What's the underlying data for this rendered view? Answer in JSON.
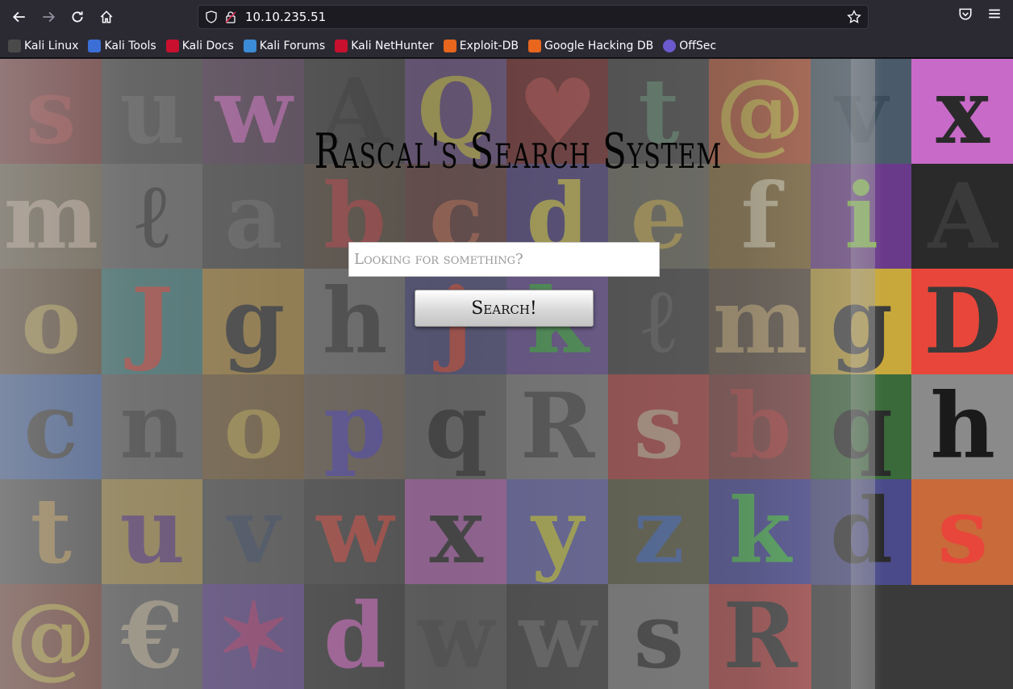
{
  "browser": {
    "url": "10.10.235.51",
    "bookmarks": [
      {
        "label": "Kali Linux",
        "color": "#4a4a4a"
      },
      {
        "label": "Kali Tools",
        "color": "#3b6fd6"
      },
      {
        "label": "Kali Docs",
        "color": "#c8102e"
      },
      {
        "label": "Kali Forums",
        "color": "#3b8bd6"
      },
      {
        "label": "Kali NetHunter",
        "color": "#c8102e"
      },
      {
        "label": "Exploit-DB",
        "color": "#e8661e"
      },
      {
        "label": "Google Hacking DB",
        "color": "#e8661e"
      },
      {
        "label": "OffSec",
        "color": "#6a5acd"
      }
    ]
  },
  "page": {
    "title": "Rascal's Search System",
    "search_placeholder": "Looking for something?",
    "search_button": "Search!"
  },
  "background_tiles": [
    {
      "ch": "s",
      "color": "#c83a3a",
      "bg": "#8a2a2a"
    },
    {
      "ch": "u",
      "color": "#6a6a6a",
      "bg": "#4b4b4b"
    },
    {
      "ch": "w",
      "color": "#e86ad6",
      "bg": "#5a3a5a"
    },
    {
      "ch": "A",
      "color": "#2a2a2a",
      "bg": "#3a3a3a"
    },
    {
      "ch": "Q",
      "color": "#d8c84a",
      "bg": "#6a4a8a"
    },
    {
      "ch": "♥",
      "color": "#c83a3a",
      "bg": "#7a1a1a"
    },
    {
      "ch": "t",
      "color": "#5a8a6a",
      "bg": "#3a3a3a"
    },
    {
      "ch": "@",
      "color": "#e8c23a",
      "bg": "#c8502a"
    },
    {
      "ch": "v",
      "color": "#3a4a5a",
      "bg": "#4a5a6a"
    },
    {
      "ch": "x",
      "color": "#2a2a2a",
      "bg": "#c86ac8"
    },
    {
      "ch": "m",
      "color": "#e8c8a8",
      "bg": "#7a6a4a"
    },
    {
      "ch": "ℓ",
      "color": "#2a2a2a",
      "bg": "#6a6a6a"
    },
    {
      "ch": "a",
      "color": "#6a6a6a",
      "bg": "#4a4a4a"
    },
    {
      "ch": "b",
      "color": "#c83a3a",
      "bg": "#5a4a3a"
    },
    {
      "ch": "c",
      "color": "#c8684a",
      "bg": "#6a3a3a"
    },
    {
      "ch": "d",
      "color": "#e8d84a",
      "bg": "#4a3a8a"
    },
    {
      "ch": "e",
      "color": "#d8b84a",
      "bg": "#6a6a5a"
    },
    {
      "ch": "f",
      "color": "#e8d8a8",
      "bg": "#8a6a2a"
    },
    {
      "ch": "i",
      "color": "#8ac84a",
      "bg": "#6a3a8a"
    },
    {
      "ch": "A",
      "color": "#3a3a3a",
      "bg": "#2a2a2a"
    },
    {
      "ch": "o",
      "color": "#d8b84a",
      "bg": "#6a4a2a"
    },
    {
      "ch": "J",
      "color": "#e8463a",
      "bg": "#3a8a8a"
    },
    {
      "ch": "g",
      "color": "#2a2a2a",
      "bg": "#c89a3a"
    },
    {
      "ch": "h",
      "color": "#3a3a3a",
      "bg": "#7a7a7a"
    },
    {
      "ch": "j",
      "color": "#e8463a",
      "bg": "#4a4a8a"
    },
    {
      "ch": "k",
      "color": "#3ab84a",
      "bg": "#6a4aa8"
    },
    {
      "ch": "ℓ",
      "color": "#5a5a5a",
      "bg": "#3a3a3a"
    },
    {
      "ch": "m",
      "color": "#c8a86a",
      "bg": "#5a4a3a"
    },
    {
      "ch": "g",
      "color": "#3a3a3a",
      "bg": "#c8a83a"
    },
    {
      "ch": "D",
      "color": "#3a3a3a",
      "bg": "#e8463a"
    },
    {
      "ch": "c",
      "color": "#2a2a2a",
      "bg": "#3a6ac8"
    },
    {
      "ch": "n",
      "color": "#3a3a3a",
      "bg": "#6a6a6a"
    },
    {
      "ch": "o",
      "color": "#d8b84a",
      "bg": "#8a6a3a"
    },
    {
      "ch": "p",
      "color": "#5a4ac8",
      "bg": "#7a6a5a"
    },
    {
      "ch": "q",
      "color": "#2a2a2a",
      "bg": "#6a6a6a"
    },
    {
      "ch": "R",
      "color": "#4a4a4a",
      "bg": "#8a8a8a"
    },
    {
      "ch": "s",
      "color": "#e8b89a",
      "bg": "#c83a3a"
    },
    {
      "ch": "b",
      "color": "#c83a3a",
      "bg": "#8a3a3a"
    },
    {
      "ch": "q",
      "color": "#2a2a2a",
      "bg": "#3a6a3a"
    },
    {
      "ch": "h",
      "color": "#1a1a1a",
      "bg": "#8a8a8a"
    },
    {
      "ch": "t",
      "color": "#d8a84a",
      "bg": "#4a4a4a"
    },
    {
      "ch": "u",
      "color": "#6a3a8a",
      "bg": "#c8a84a"
    },
    {
      "ch": "v",
      "color": "#3a4a6a",
      "bg": "#5a5a5a"
    },
    {
      "ch": "w",
      "color": "#e8463a",
      "bg": "#4a4a4a"
    },
    {
      "ch": "x",
      "color": "#2a2a2a",
      "bg": "#c86ac8"
    },
    {
      "ch": "y",
      "color": "#e8e84a",
      "bg": "#6a6ac8"
    },
    {
      "ch": "z",
      "color": "#3a6ac8",
      "bg": "#5a5a3a"
    },
    {
      "ch": "k",
      "color": "#3ac84a",
      "bg": "#3a3aa8"
    },
    {
      "ch": "d",
      "color": "#2a2a2a",
      "bg": "#4a4a8a"
    },
    {
      "ch": "s",
      "color": "#e8463a",
      "bg": "#c86a3a"
    },
    {
      "ch": "@",
      "color": "#e8c23a",
      "bg": "#8a3a2a"
    },
    {
      "ch": "€",
      "color": "#d8c8a8",
      "bg": "#6a6a6a"
    },
    {
      "ch": "✶",
      "color": "#c83a8a",
      "bg": "#6a4aa8"
    },
    {
      "ch": "d",
      "color": "#e86ad6",
      "bg": "#3a3a3a"
    },
    {
      "ch": "w",
      "color": "#4a4a4a",
      "bg": "#5a5a5a"
    },
    {
      "ch": "w",
      "color": "#6a6a6a",
      "bg": "#3a3a3a"
    },
    {
      "ch": "s",
      "color": "#2a2a2a",
      "bg": "#8a8a8a"
    },
    {
      "ch": "R",
      "color": "#2a2a2a",
      "bg": "#c83a3a"
    }
  ]
}
